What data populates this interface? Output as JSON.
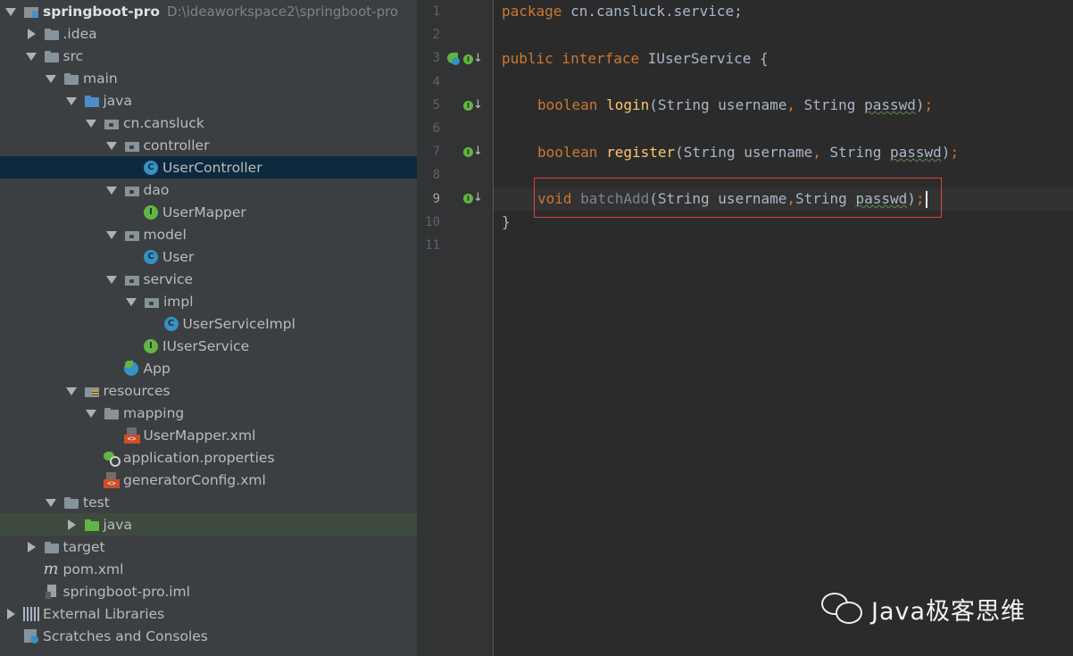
{
  "project": {
    "name": "springboot-pro",
    "path": "D:\\ideaworkspace2\\springboot-pro"
  },
  "tree": [
    {
      "label": "springboot-pro",
      "arrow": "down",
      "icon": "project-icon"
    },
    {
      "label": ".idea",
      "arrow": "right",
      "icon": "folder-icon"
    },
    {
      "label": "src",
      "arrow": "down",
      "icon": "folder-icon"
    },
    {
      "label": "main",
      "arrow": "down",
      "icon": "folder-icon"
    },
    {
      "label": "java",
      "arrow": "down",
      "icon": "source-folder-icon"
    },
    {
      "label": "cn.cansluck",
      "arrow": "down",
      "icon": "package-icon"
    },
    {
      "label": "controller",
      "arrow": "down",
      "icon": "package-icon"
    },
    {
      "label": "UserController",
      "arrow": "none",
      "icon": "class-icon",
      "selected": true
    },
    {
      "label": "dao",
      "arrow": "down",
      "icon": "package-icon"
    },
    {
      "label": "UserMapper",
      "arrow": "none",
      "icon": "interface-icon"
    },
    {
      "label": "model",
      "arrow": "down",
      "icon": "package-icon"
    },
    {
      "label": "User",
      "arrow": "none",
      "icon": "class-icon"
    },
    {
      "label": "service",
      "arrow": "down",
      "icon": "package-icon"
    },
    {
      "label": "impl",
      "arrow": "down",
      "icon": "package-icon"
    },
    {
      "label": "UserServiceImpl",
      "arrow": "none",
      "icon": "class-icon"
    },
    {
      "label": "IUserService",
      "arrow": "none",
      "icon": "interface-icon"
    },
    {
      "label": "App",
      "arrow": "none",
      "icon": "spring-boot-app-icon"
    },
    {
      "label": "resources",
      "arrow": "down",
      "icon": "resources-folder-icon"
    },
    {
      "label": "mapping",
      "arrow": "down",
      "icon": "folder-icon"
    },
    {
      "label": "UserMapper.xml",
      "arrow": "none",
      "icon": "xml-file-icon"
    },
    {
      "label": "application.properties",
      "arrow": "none",
      "icon": "properties-file-icon"
    },
    {
      "label": "generatorConfig.xml",
      "arrow": "none",
      "icon": "xml-file-icon"
    },
    {
      "label": "test",
      "arrow": "down",
      "icon": "folder-icon"
    },
    {
      "label": "java",
      "arrow": "right",
      "icon": "test-folder-icon",
      "highlighted": true
    },
    {
      "label": "target",
      "arrow": "right",
      "icon": "folder-icon"
    },
    {
      "label": "pom.xml",
      "arrow": "none",
      "icon": "maven-icon"
    },
    {
      "label": "springboot-pro.iml",
      "arrow": "none",
      "icon": "iml-file-icon"
    },
    {
      "label": "External Libraries",
      "arrow": "right",
      "icon": "library-icon"
    },
    {
      "label": "Scratches and Consoles",
      "arrow": "none",
      "icon": "scratches-icon"
    }
  ],
  "editor": {
    "line_numbers": [
      "1",
      "2",
      "3",
      "4",
      "5",
      "6",
      "7",
      "8",
      "9",
      "10",
      "11"
    ],
    "current_line": "9",
    "code": {
      "l1_kw": "package",
      "l1_rest": " cn.cansluck.service;",
      "l3_kw1": "public",
      "l3_kw2": " interface",
      "l3_rest": " IUserService {",
      "l5_kw": "boolean",
      "l5_fn": " login",
      "l5_a": "(String username",
      "l5_comma": ",",
      "l5_b": " String ",
      "l5_p": "passwd",
      "l5_end": ")",
      "l5_semi": ";",
      "l7_kw": "boolean",
      "l7_fn": " register",
      "l7_a": "(String username",
      "l7_comma": ",",
      "l7_b": " String ",
      "l7_p": "passwd",
      "l7_end": ")",
      "l7_semi": ";",
      "l9_kw": "void",
      "l9_fn": " batchAdd",
      "l9_a": "(String username",
      "l9_comma": ",",
      "l9_b": "String ",
      "l9_p": "passwd",
      "l9_end": ")",
      "l9_semi": ";",
      "l10": "}"
    }
  },
  "watermark": {
    "text": "Java极客思维",
    "icon": "wechat-icon"
  }
}
